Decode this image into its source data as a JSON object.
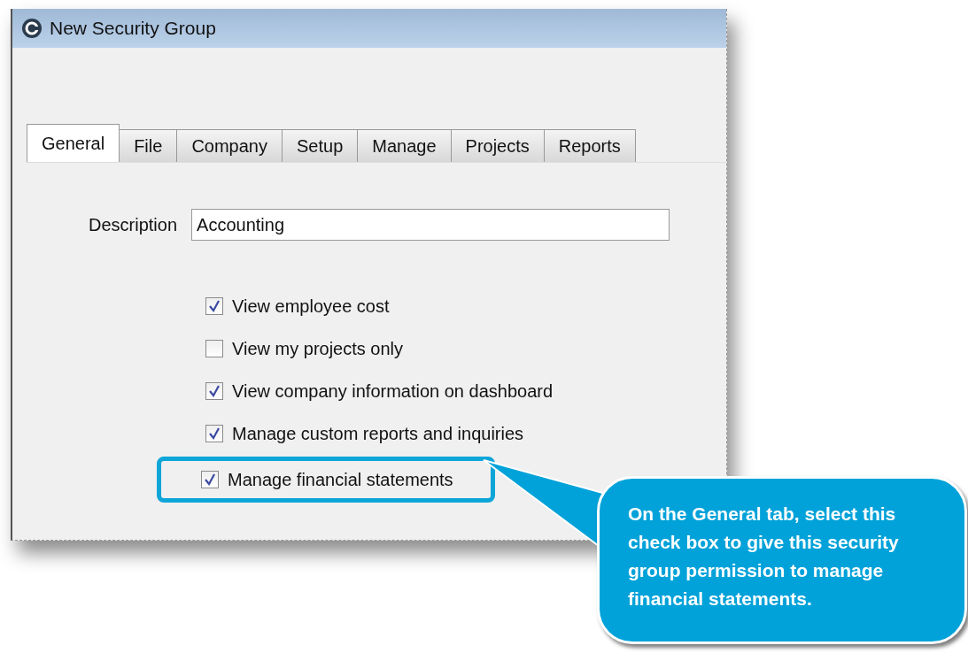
{
  "window": {
    "title": "New Security Group"
  },
  "tabs": [
    {
      "label": "General",
      "selected": true
    },
    {
      "label": "File",
      "selected": false
    },
    {
      "label": "Company",
      "selected": false
    },
    {
      "label": "Setup",
      "selected": false
    },
    {
      "label": "Manage",
      "selected": false
    },
    {
      "label": "Projects",
      "selected": false
    },
    {
      "label": "Reports",
      "selected": false
    }
  ],
  "description": {
    "label": "Description",
    "value": "Accounting"
  },
  "options": [
    {
      "label": "View employee cost",
      "checked": true,
      "highlighted": false
    },
    {
      "label": "View my projects only",
      "checked": false,
      "highlighted": false
    },
    {
      "label": "View company information on dashboard",
      "checked": true,
      "highlighted": false
    },
    {
      "label": "Manage custom reports and inquiries",
      "checked": true,
      "highlighted": false
    },
    {
      "label": "Manage financial statements",
      "checked": true,
      "highlighted": true
    }
  ],
  "callout": {
    "text": "On the General tab, select this check box to give this security group permission to manage financial statements."
  }
}
